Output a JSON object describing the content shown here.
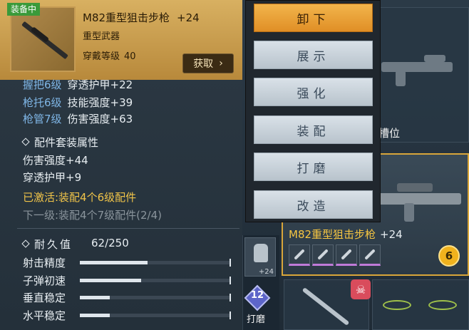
{
  "equipped_tag": "装备中",
  "item": {
    "name": "M82重型狙击步枪",
    "plus": "+24",
    "type": "重型武器",
    "level_label": "穿戴等级",
    "level_value": "40",
    "obtain_label": "获取",
    "obtain_chevron": "chevron-right-icon"
  },
  "parts": [
    {
      "part": "握把6级",
      "stat": "穿透护甲+22"
    },
    {
      "part": "枪托6级",
      "stat": "技能强度+39"
    },
    {
      "part": "枪管7级",
      "stat": "伤害强度+63"
    }
  ],
  "set_section": {
    "title": "配件套装属性",
    "lines": [
      "伤害强度+44",
      "穿透护甲+9"
    ],
    "active": "已激活:装配4个6级配件",
    "next": "下一级:装配4个7级配件(2/4)"
  },
  "durability": {
    "label": "耐久值",
    "value": "62/250"
  },
  "bars": [
    {
      "label": "射击精度",
      "fraction": 0.45
    },
    {
      "label": "子弹初速",
      "fraction": 0.41
    },
    {
      "label": "垂直稳定",
      "fraction": 0.2
    },
    {
      "label": "水平稳定",
      "fraction": 0.2
    }
  ],
  "menu": {
    "buttons": [
      "卸下",
      "展示",
      "强化",
      "装配",
      "打磨",
      "改造"
    ]
  },
  "background": {
    "slot_label": "槽位",
    "weapon_name": "M82重型狙击步枪",
    "weapon_plus": "+24",
    "level_badge": "6",
    "glove_plus": "+24",
    "polish_num": "12",
    "polish_label": "打磨"
  },
  "colors": {
    "accent_gold": "#d9a63a",
    "primary_button": "#e08f26",
    "equipped_green": "#3a9a3a",
    "part_blue": "#7fb6e6",
    "active_yellow": "#f0c449"
  }
}
